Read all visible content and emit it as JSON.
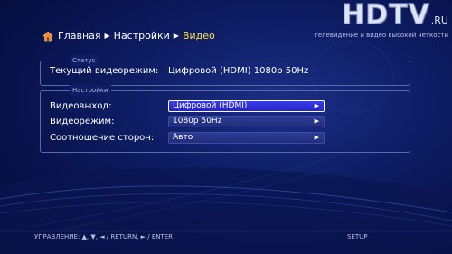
{
  "watermark": {
    "logo": "HDTV",
    "domain": ".RU",
    "tagline": "телевидение и видео высокой четкости"
  },
  "breadcrumb": {
    "items": [
      "Главная",
      "Настройки",
      "Видео"
    ]
  },
  "status": {
    "title": "Статус",
    "label": "Текущий видеорежим:",
    "value": "Цифровой (HDMI) 1080p 50Hz"
  },
  "settings": {
    "title": "Настройки",
    "rows": [
      {
        "label": "Видеовыход:",
        "value": "Цифровой (HDMI)"
      },
      {
        "label": "Видеорежим:",
        "value": "1080p 50Hz"
      },
      {
        "label": "Соотношение сторон:",
        "value": "Авто"
      }
    ]
  },
  "footer": {
    "controls": "УПРАВЛЕНИЕ:  ▲, ▼, ◄ / RETURN, ► / ENTER",
    "setup": "SETUP"
  },
  "colors": {
    "accent": "#ffe23c",
    "selected_bg": "#2f2fd8",
    "background": "#0e1d64"
  }
}
